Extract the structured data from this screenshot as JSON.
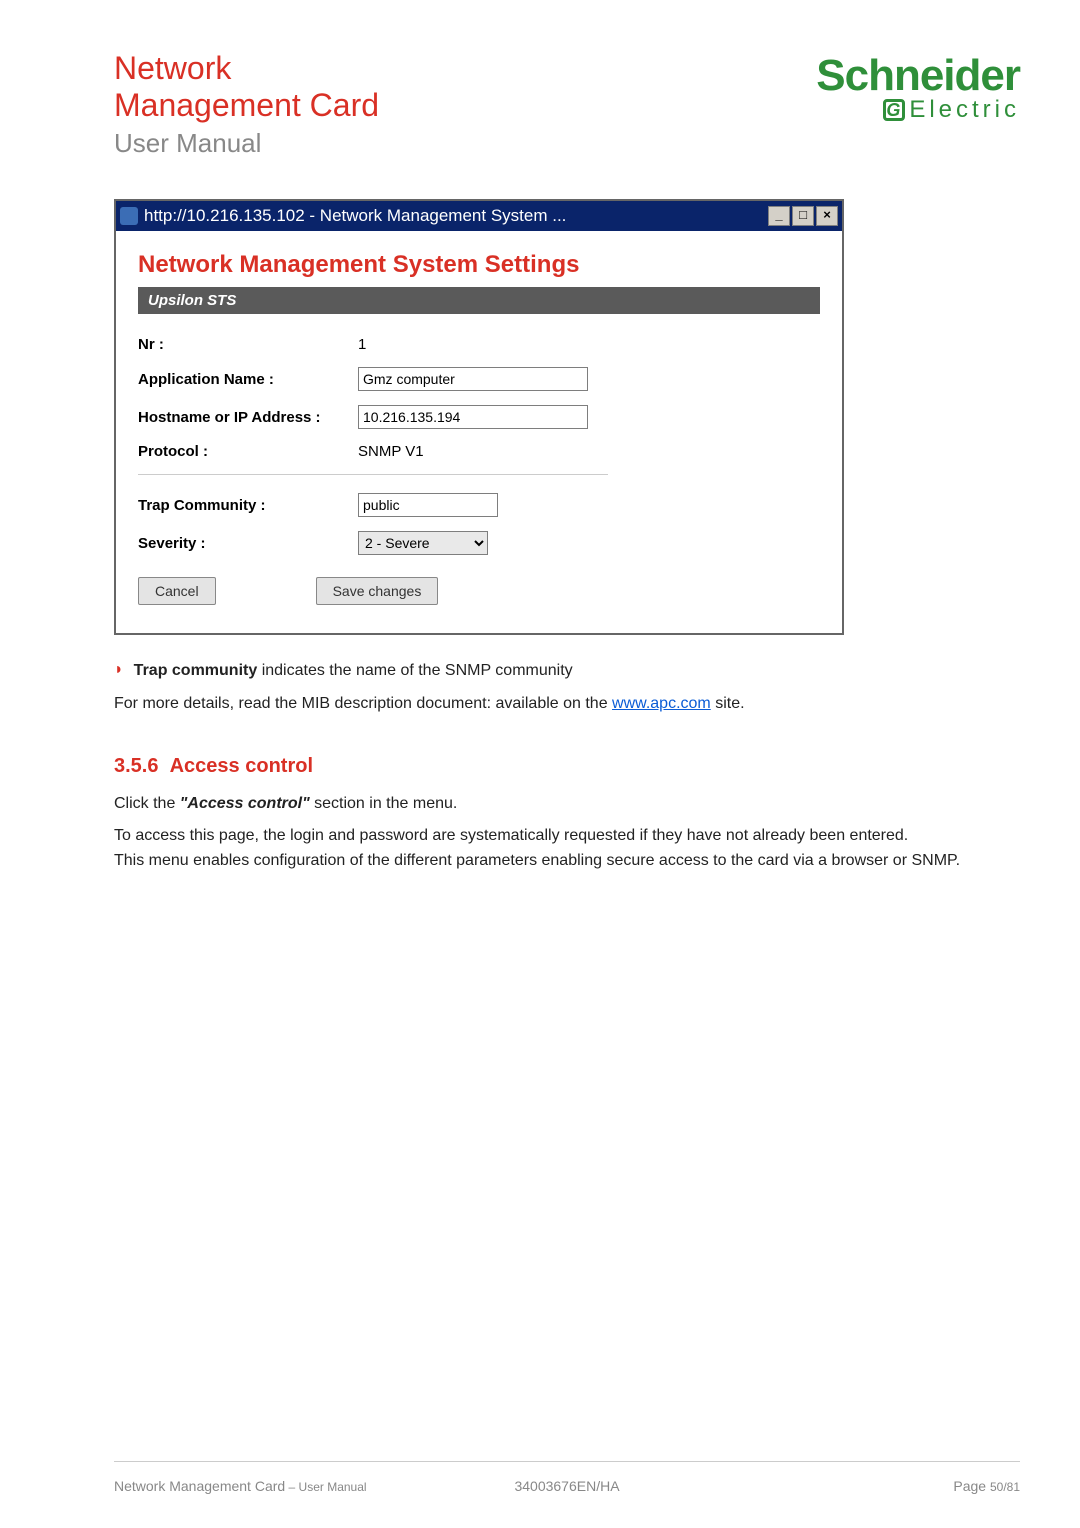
{
  "header": {
    "title_line1": "Network",
    "title_line2": "Management Card",
    "subtitle": "User Manual",
    "brand_top": "Schneider",
    "brand_sub": "Electric"
  },
  "window": {
    "titlebar": "http://10.216.135.102 - Network Management System ...",
    "min_glyph": "_",
    "max_glyph": "□",
    "close_glyph": "×",
    "heading": "Network Management System Settings",
    "tab_label": "Upsilon STS",
    "rows": {
      "nr_label": "Nr :",
      "nr_value": "1",
      "appname_label": "Application Name :",
      "appname_value": "Gmz computer",
      "host_label": "Hostname or IP Address :",
      "host_value": "10.216.135.194",
      "protocol_label": "Protocol :",
      "protocol_value": "SNMP V1",
      "trap_label": "Trap Community :",
      "trap_value": "public",
      "severity_label": "Severity :",
      "severity_value": "2 - Severe"
    },
    "cancel_label": "Cancel",
    "save_label": "Save changes"
  },
  "content": {
    "bullet_bold": "Trap community",
    "bullet_rest": " indicates the name of the SNMP community",
    "details_pre": "For more details, read the MIB description document: available on the ",
    "details_link": "www.apc.com",
    "details_post": " site.",
    "section_number": "3.5.6",
    "section_title": "Access control",
    "p1_pre": "Click the ",
    "p1_bold": "\"Access control\"",
    "p1_post": " section in the menu.",
    "p2": "To access this page, the login and password are systematically requested if they have not already been entered.",
    "p3": "This menu enables configuration of the different parameters enabling secure access to the card via a browser or SNMP."
  },
  "footer": {
    "left_main": "Network Management Card",
    "left_sub": " – User Manual",
    "center": "34003676EN/HA",
    "right_label": "Page ",
    "right_num": "50/81"
  }
}
